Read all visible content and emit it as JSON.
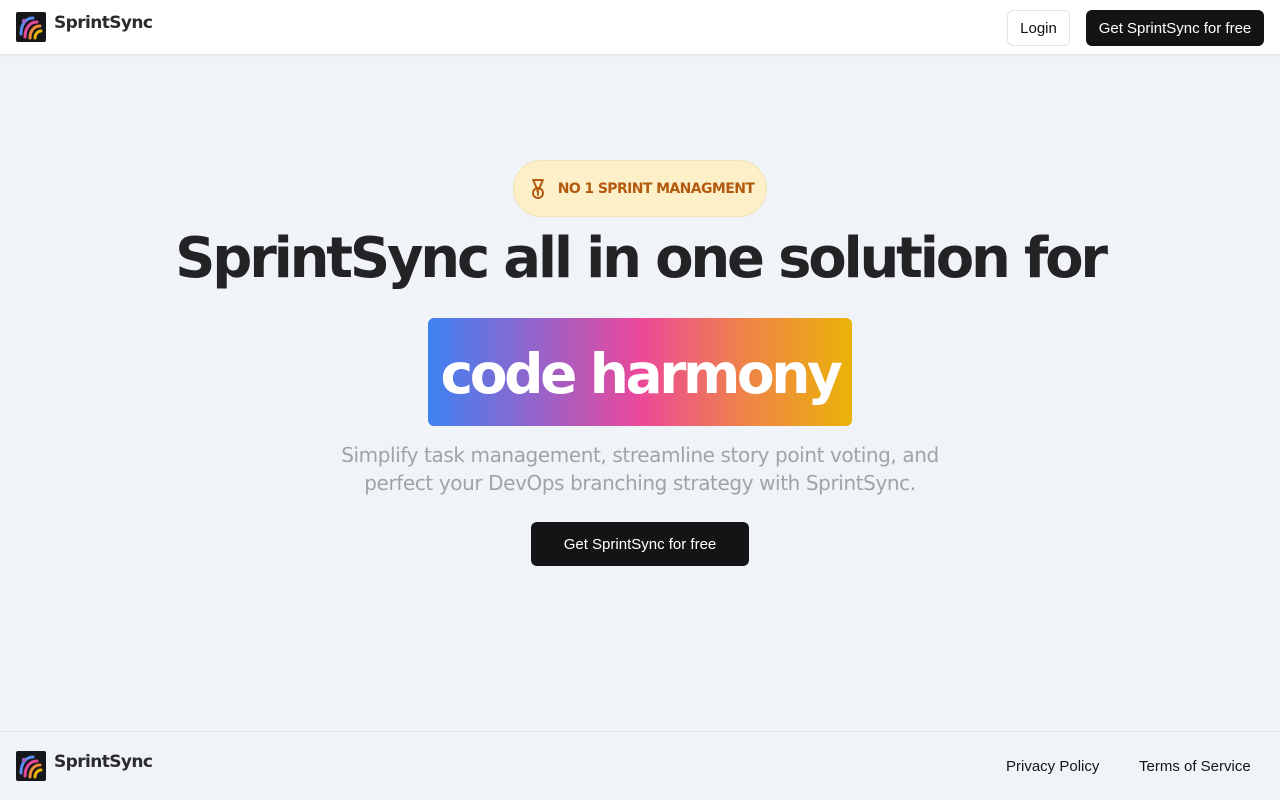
{
  "brand": {
    "name": "SprintSync",
    "logo_icon": "sprintsync-logo-icon"
  },
  "header": {
    "login_label": "Login",
    "cta_label": "Get SprintSync for free"
  },
  "hero": {
    "badge_icon": "medal-icon",
    "badge_label": "NO 1 SPRINT MANAGMENT",
    "headline": "SprintSync all in one solution for",
    "highlight": "code harmony",
    "subtitle": "Simplify task management, streamline story point voting, and perfect your DevOps branching strategy with SprintSync.",
    "cta_label": "Get SprintSync for free"
  },
  "footer": {
    "brand_name": "SprintSync",
    "links": [
      "Privacy Policy",
      "Terms of Service"
    ]
  },
  "colors": {
    "page_background": "#f0f3f8",
    "dark_button": "#141416",
    "badge_background": "#fdf0c8",
    "badge_text": "#b45a0e",
    "gradient": [
      "#3e82f2",
      "#a45ec3",
      "#ec4899",
      "#ef8448",
      "#eab308"
    ]
  }
}
